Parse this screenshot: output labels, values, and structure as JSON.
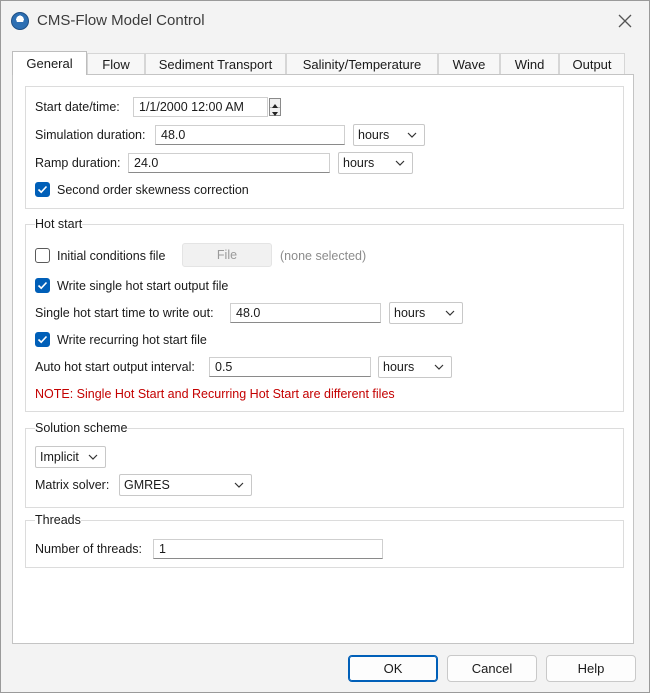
{
  "window": {
    "title": "CMS-Flow Model Control"
  },
  "tabs": [
    {
      "label": "General",
      "active": true
    },
    {
      "label": "Flow"
    },
    {
      "label": "Sediment Transport"
    },
    {
      "label": "Salinity/Temperature"
    },
    {
      "label": "Wave"
    },
    {
      "label": "Wind"
    },
    {
      "label": "Output"
    }
  ],
  "general": {
    "start_label": "Start date/time:",
    "start_value": "1/1/2000 12:00 AM",
    "sim_label": "Simulation duration:",
    "sim_value": "48.0",
    "sim_unit": "hours",
    "ramp_label": "Ramp duration:",
    "ramp_value": "24.0",
    "ramp_unit": "hours",
    "skew_label": "Second order skewness correction",
    "skew_checked": true
  },
  "hot_start": {
    "title": "Hot start",
    "init_label": "Initial conditions file",
    "init_checked": false,
    "file_button": "File",
    "file_status": "(none selected)",
    "single_label": "Write single hot start output file",
    "single_checked": true,
    "single_time_label": "Single hot start time to write out:",
    "single_time_value": "48.0",
    "single_time_unit": "hours",
    "recurring_label": "Write recurring hot start file",
    "recurring_checked": true,
    "interval_label": "Auto hot start output interval:",
    "interval_value": "0.5",
    "interval_unit": "hours",
    "note": "NOTE: Single Hot Start and Recurring Hot Start are different files"
  },
  "solution": {
    "title": "Solution scheme",
    "scheme_value": "Implicit",
    "solver_label": "Matrix solver:",
    "solver_value": "GMRES"
  },
  "threads": {
    "title": "Threads",
    "count_label": "Number of threads:",
    "count_value": "1"
  },
  "buttons": {
    "ok": "OK",
    "cancel": "Cancel",
    "help": "Help"
  },
  "colors": {
    "accent": "#005fb8",
    "note": "#c40000"
  }
}
